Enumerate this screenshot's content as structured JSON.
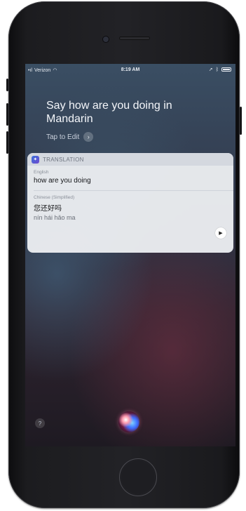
{
  "status_bar": {
    "carrier": "Verizon",
    "time": "8:19 AM"
  },
  "siri": {
    "request_text": "Say how are you doing in Mandarin",
    "tap_to_edit": "Tap to Edit"
  },
  "translation_card": {
    "header": "TRANSLATION",
    "source": {
      "language": "English",
      "text": "how are you doing"
    },
    "target": {
      "language": "Chinese (Simplified)",
      "text": "您还好吗",
      "pinyin": "nín hái hǎo ma"
    }
  },
  "icons": {
    "app": "translation-icon",
    "play": "play-icon",
    "help": "help-icon",
    "siri": "siri-orb-icon",
    "edit_chevron": "chevron-right-icon"
  }
}
